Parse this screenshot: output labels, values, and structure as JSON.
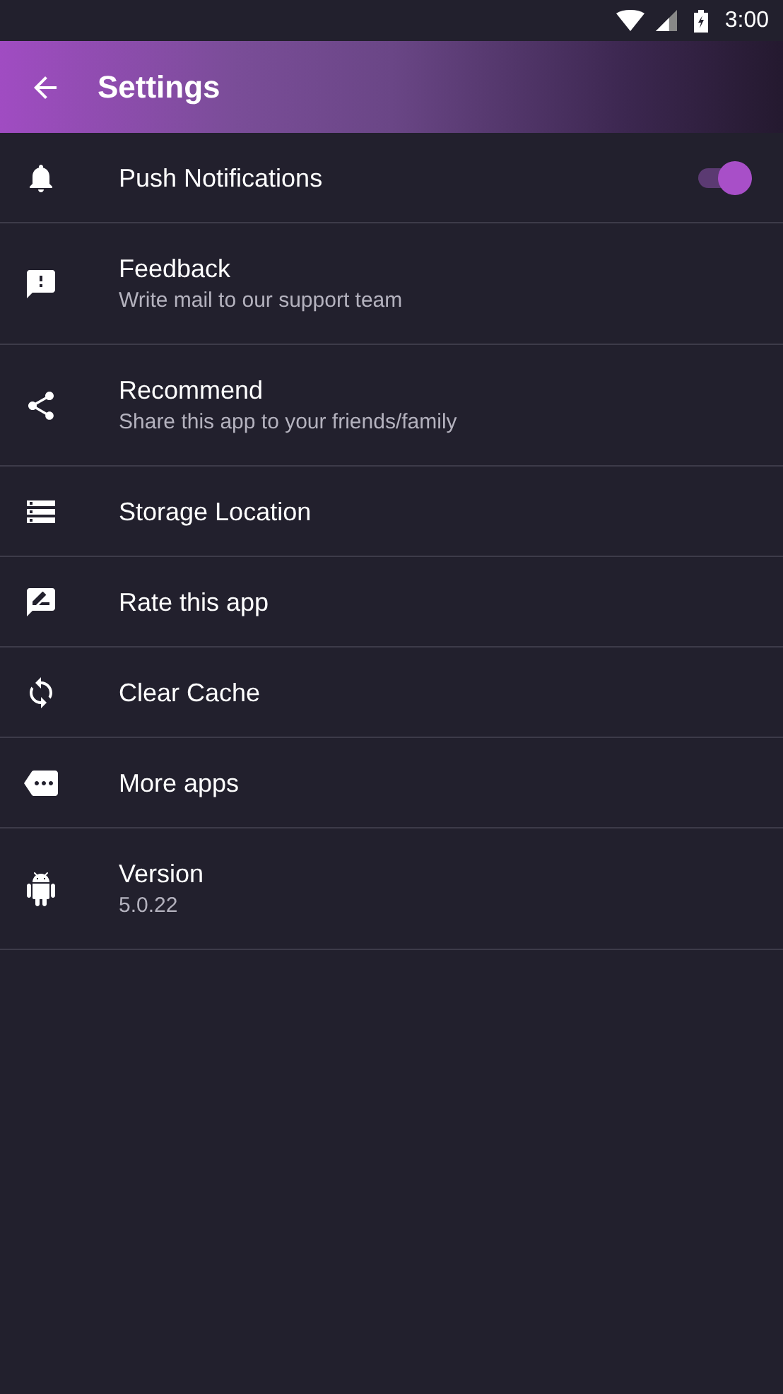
{
  "status_bar": {
    "time": "3:00"
  },
  "app_bar": {
    "title": "Settings"
  },
  "items": [
    {
      "kind": "toggle",
      "title": "Push Notifications",
      "on": true
    },
    {
      "kind": "plain",
      "title": "Feedback",
      "subtitle": "Write mail to our support team"
    },
    {
      "kind": "plain",
      "title": "Recommend",
      "subtitle": "Share this app to your friends/family"
    },
    {
      "kind": "plain",
      "title": "Storage Location"
    },
    {
      "kind": "plain",
      "title": "Rate this app"
    },
    {
      "kind": "plain",
      "title": "Clear Cache"
    },
    {
      "kind": "plain",
      "title": "More apps"
    },
    {
      "kind": "plain",
      "title": "Version",
      "subtitle": "5.0.22"
    }
  ]
}
